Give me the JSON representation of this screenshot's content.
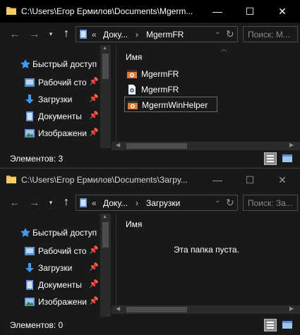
{
  "windows": [
    {
      "title": "C:\\Users\\Егор Ермилов\\Documents\\Mgerm...",
      "controls": {
        "minimize": "—",
        "maximize": "☐",
        "close": "✕"
      },
      "nav": {
        "back": "←",
        "forward": "→",
        "recent": "▾",
        "up": "↑"
      },
      "address": {
        "overflow": "«",
        "crumbs": [
          "Доку...",
          "MgermFR"
        ],
        "sep": "›",
        "dropdown": "⌄",
        "refresh": "↻"
      },
      "search_placeholder": "Поиск: M...",
      "sidebar": [
        {
          "label": "Быстрый доступ",
          "icon": "star-icon",
          "pinned": false
        },
        {
          "label": "Рабочий сто",
          "icon": "desktop-folder-icon",
          "pinned": true
        },
        {
          "label": "Загрузки",
          "icon": "download-arrow-icon",
          "pinned": true
        },
        {
          "label": "Документы",
          "icon": "documents-icon",
          "pinned": true
        },
        {
          "label": "Изображени",
          "icon": "pictures-icon",
          "pinned": true
        }
      ],
      "column_header": "Имя",
      "files": [
        {
          "name": "MgermFR",
          "icon": "app-exe-icon",
          "selected": false
        },
        {
          "name": "MgermFR",
          "icon": "config-file-icon",
          "selected": false
        },
        {
          "name": "MgermWinHelper",
          "icon": "app-exe-icon",
          "selected": true
        }
      ],
      "empty_message": "",
      "status": "Элементов: 3",
      "pin_glyph": "📌"
    },
    {
      "title": "C:\\Users\\Егор Ермилов\\Documents\\Загру...",
      "controls": {
        "minimize": "—",
        "maximize": "☐",
        "close": "✕"
      },
      "nav": {
        "back": "←",
        "forward": "→",
        "recent": "▾",
        "up": "↑"
      },
      "address": {
        "overflow": "«",
        "crumbs": [
          "Доку...",
          "Загрузки"
        ],
        "sep": "›",
        "dropdown": "⌄",
        "refresh": "↻"
      },
      "search_placeholder": "Поиск: За...",
      "sidebar": [
        {
          "label": "Быстрый доступ",
          "icon": "star-icon",
          "pinned": false
        },
        {
          "label": "Рабочий сто",
          "icon": "desktop-folder-icon",
          "pinned": true
        },
        {
          "label": "Загрузки",
          "icon": "download-arrow-icon",
          "pinned": true
        },
        {
          "label": "Документы",
          "icon": "documents-icon",
          "pinned": true
        },
        {
          "label": "Изображени",
          "icon": "pictures-icon",
          "pinned": true
        }
      ],
      "column_header": "Имя",
      "files": [],
      "empty_message": "Эта папка пуста.",
      "status": "Элементов: 0",
      "pin_glyph": "📌"
    }
  ],
  "colors": {
    "background": "#191919",
    "titlebar_active": "#000000",
    "text": "#ffffff",
    "muted": "#8a8a8a",
    "accent_star": "#3f9bf0",
    "folder_blue": "#5b8fd6",
    "exe_orange": "#e8762b"
  }
}
